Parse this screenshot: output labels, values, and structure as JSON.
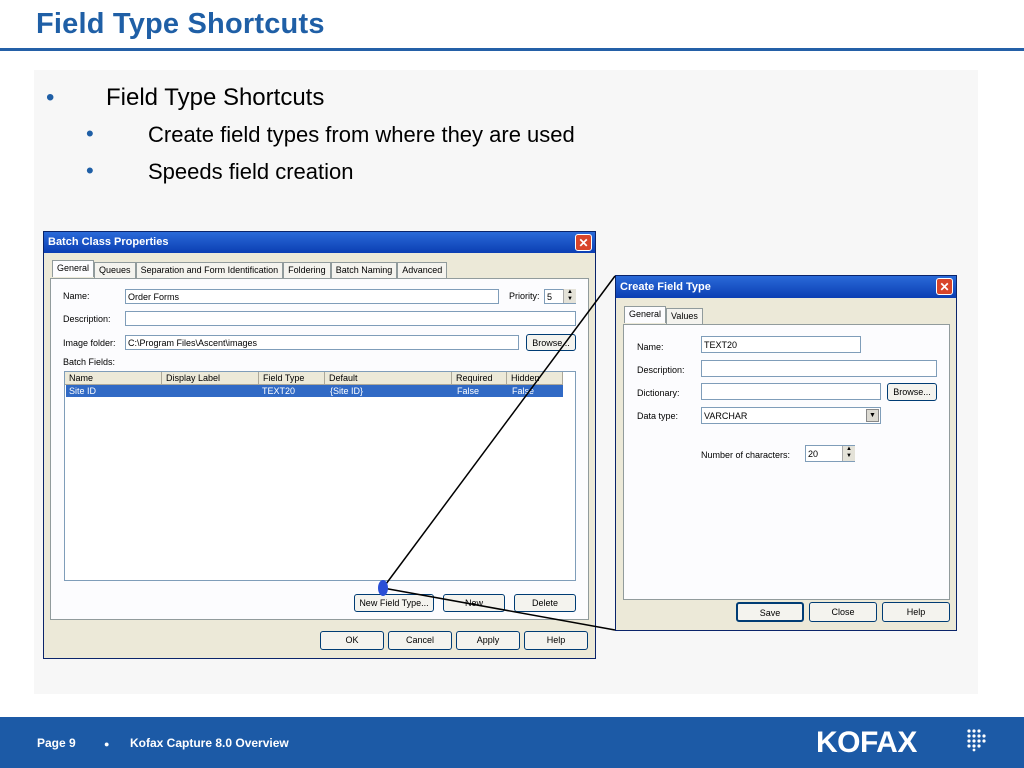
{
  "slide": {
    "title": "Field Type Shortcuts",
    "bullets": {
      "main": "Field Type Shortcuts",
      "sub1": "Create field types from where they are used",
      "sub2": "Speeds field creation",
      "marker": "•"
    }
  },
  "batch_dialog": {
    "title": "Batch Class Properties",
    "tabs": [
      "General",
      "Queues",
      "Separation and Form Identification",
      "Foldering",
      "Batch Naming",
      "Advanced"
    ],
    "name_label": "Name:",
    "name_value": "Order Forms",
    "priority_label": "Priority:",
    "priority_value": "5",
    "description_label": "Description:",
    "description_value": "",
    "image_folder_label": "Image folder:",
    "image_folder_value": "C:\\Program Files\\Ascent\\images",
    "browse_label": "Browse...",
    "batch_fields_label": "Batch Fields:",
    "columns": [
      "Name",
      "Display Label",
      "Field Type",
      "Default",
      "Required",
      "Hidden"
    ],
    "rows": [
      {
        "name": "Site ID",
        "display_label": "",
        "field_type": "TEXT20",
        "default": "{Site ID}",
        "required": "False",
        "hidden": "False"
      }
    ],
    "new_field_type_label": "New Field Type...",
    "new_label": "New",
    "delete_label": "Delete",
    "ok_label": "OK",
    "cancel_label": "Cancel",
    "apply_label": "Apply",
    "help_label": "Help"
  },
  "field_type_dialog": {
    "title": "Create Field Type",
    "tabs": [
      "General",
      "Values"
    ],
    "name_label": "Name:",
    "name_value": "TEXT20",
    "description_label": "Description:",
    "description_value": "",
    "dictionary_label": "Dictionary:",
    "dictionary_value": "",
    "browse_label": "Browse...",
    "data_type_label": "Data type:",
    "data_type_value": "VARCHAR",
    "num_chars_label": "Number of characters:",
    "num_chars_value": "20",
    "save_label": "Save",
    "close_label": "Close",
    "help_label": "Help"
  },
  "footer": {
    "page": "Page 9",
    "separator": "●",
    "product": "Kofax Capture 8.0 Overview",
    "logo": "KOFAX"
  },
  "colors": {
    "title_blue": "#1f5fa6",
    "footer_blue": "#1c5aa6",
    "selection_blue": "#316ac5"
  }
}
